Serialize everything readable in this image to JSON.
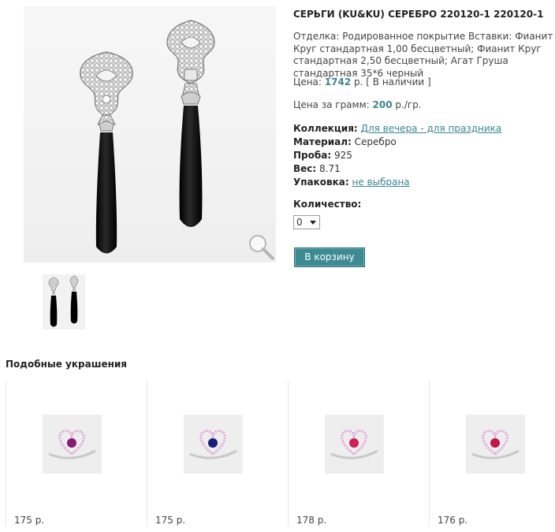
{
  "product": {
    "title": "СЕРЬГИ (KU&KU) СЕРЕБРО 220120-1 220120-1",
    "description": "Отделка: Родированное покрытие Вставки: Фианит Круг стандартная 1,00 бесцветный; Фианит Круг стандартная 2,50 бесцветный; Агат Груша стандартная 35*6 черный",
    "price_label": "Цена:",
    "price_value": "1742",
    "price_currency": "р.",
    "availability": "[ В наличии ]",
    "gram_label": "Цена за грамм:",
    "gram_value": "200",
    "gram_unit": "р./гр.",
    "collection_label": "Коллекция:",
    "collection_value": "Для вечера - для праздника",
    "material_label": "Материал:",
    "material_value": "Серебро",
    "probe_label": "Проба:",
    "probe_value": "925",
    "weight_label": "Вес:",
    "weight_value": "8.71",
    "package_label": "Упаковка:",
    "package_value": "не выбрана",
    "quantity_label": "Количество:",
    "quantity_value": "0",
    "cart_button": "В корзину"
  },
  "similar": {
    "title": "Подобные украшения",
    "items": [
      {
        "price": "175 р.",
        "stone_color": "#8a1a7a"
      },
      {
        "price": "175 р.",
        "stone_color": "#1a1f7a"
      },
      {
        "price": "178 р.",
        "stone_color": "#d0205a"
      },
      {
        "price": "176 р.",
        "stone_color": "#c01848"
      }
    ]
  },
  "colors": {
    "accent": "#3a8590",
    "button": "#3d8a92"
  }
}
